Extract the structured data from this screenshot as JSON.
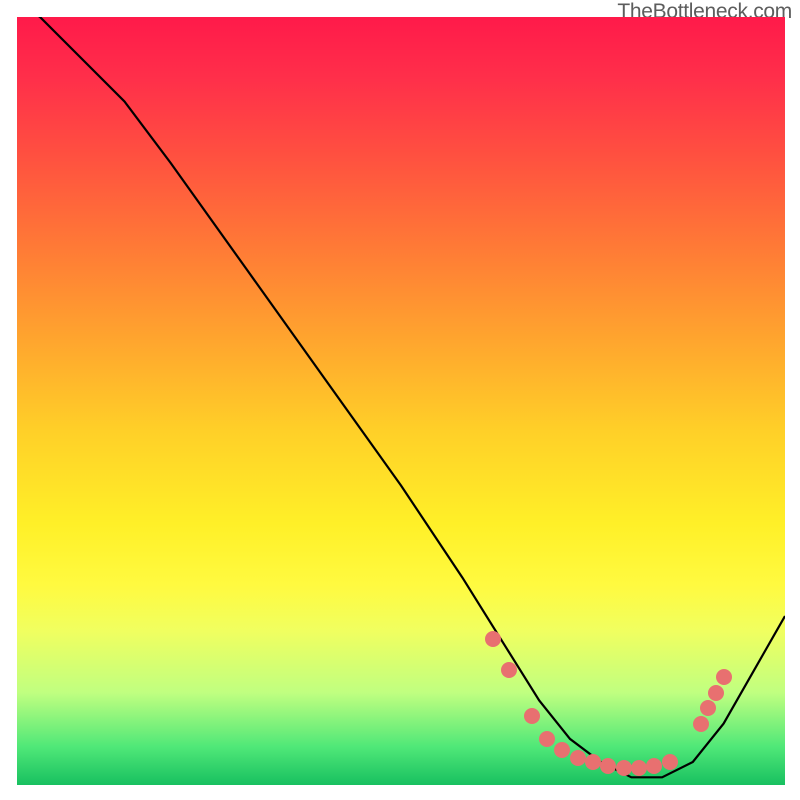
{
  "attribution": "TheBottleneck.com",
  "chart_data": {
    "type": "line",
    "title": "",
    "xlabel": "",
    "ylabel": "",
    "xlim": [
      0,
      100
    ],
    "ylim": [
      0,
      100
    ],
    "background_gradient": {
      "top": "#ff1a4a",
      "middle": "#ffe028",
      "bottom": "#18c060"
    },
    "series": [
      {
        "name": "curve",
        "x": [
          0,
          3,
          8,
          14,
          20,
          30,
          40,
          50,
          58,
          63,
          68,
          72,
          76,
          80,
          84,
          88,
          92,
          96,
          100
        ],
        "y": [
          102,
          100,
          95,
          89,
          81,
          67,
          53,
          39,
          27,
          19,
          11,
          6,
          3,
          1,
          1,
          3,
          8,
          15,
          22
        ]
      }
    ],
    "markers": {
      "name": "highlight-points",
      "color": "#e87070",
      "points": [
        {
          "x": 62,
          "y": 19
        },
        {
          "x": 64,
          "y": 15
        },
        {
          "x": 67,
          "y": 9
        },
        {
          "x": 69,
          "y": 6
        },
        {
          "x": 71,
          "y": 4.5
        },
        {
          "x": 73,
          "y": 3.5
        },
        {
          "x": 75,
          "y": 3
        },
        {
          "x": 77,
          "y": 2.5
        },
        {
          "x": 79,
          "y": 2.2
        },
        {
          "x": 81,
          "y": 2.2
        },
        {
          "x": 83,
          "y": 2.5
        },
        {
          "x": 85,
          "y": 3
        },
        {
          "x": 89,
          "y": 8
        },
        {
          "x": 90,
          "y": 10
        },
        {
          "x": 91,
          "y": 12
        },
        {
          "x": 92,
          "y": 14
        }
      ]
    }
  }
}
